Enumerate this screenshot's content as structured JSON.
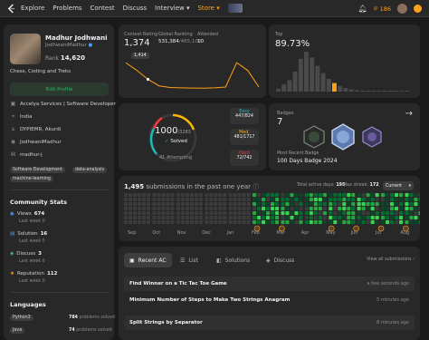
{
  "nav": {
    "items": [
      "Explore",
      "Problems",
      "Contest",
      "Discuss",
      "Interview",
      "Store"
    ],
    "streak": "186",
    "accent": "#ffa116"
  },
  "profile": {
    "name": "Madhur Jodhwani",
    "handle": "JodhwaniMadhur",
    "rank_label": "Rank",
    "rank_value": "14,620",
    "bio": "Chess, Coding and Treks",
    "edit_label": "Edit Profile",
    "work": "Accelya Services | Software Developer",
    "country": "India",
    "school": "DYPIEMR, Akurdi",
    "github": "JodhwaniMadhur",
    "website": "madhur-j",
    "tags": [
      "Software Development",
      "data-analysis",
      "machine-learning"
    ],
    "community_title": "Community Stats",
    "stats": [
      {
        "label": "Views",
        "value": "674",
        "sub": "Last week",
        "delta": "0",
        "icon": "eye-icon",
        "color": "#4a9ff5"
      },
      {
        "label": "Solution",
        "value": "16",
        "sub": "Last week",
        "delta": "0",
        "icon": "solution-icon",
        "color": "#4a9ff5"
      },
      {
        "label": "Discuss",
        "value": "3",
        "sub": "Last week",
        "delta": "0",
        "icon": "discuss-icon",
        "color": "#4ec9a4"
      },
      {
        "label": "Reputation",
        "value": "112",
        "sub": "Last week",
        "delta": "0",
        "icon": "reputation-icon",
        "color": "#ffa116"
      }
    ],
    "languages_title": "Languages",
    "languages": [
      {
        "name": "Python3",
        "count": "784",
        "suffix": "problems solved"
      },
      {
        "name": "Java",
        "count": "74",
        "suffix": "problems solved"
      }
    ]
  },
  "contest": {
    "rating_label": "Contest Rating",
    "rating": "1,374",
    "global_label": "Global Ranking",
    "global": "531,384",
    "global_total": "/465,100",
    "attended_label": "Attended",
    "attended": "10",
    "tooltip": "1,414",
    "rating_series": [
      1500,
      1460,
      1414,
      1380,
      1372,
      1370,
      1369,
      1368,
      1370,
      1374,
      1500,
      1460,
      1374
    ]
  },
  "top": {
    "label": "Top",
    "value": "89.73%",
    "bars": [
      4,
      10,
      16,
      28,
      46,
      56,
      48,
      36,
      26,
      18,
      12,
      8,
      5,
      3,
      2,
      1,
      1,
      1,
      1,
      1,
      1,
      1,
      1,
      1
    ],
    "highlight_index": 10
  },
  "solved": {
    "count": "1000",
    "total": "/3283",
    "label": "Solved",
    "attempting": "41 Attempting",
    "easy": {
      "label": "Easy",
      "value": "447/824",
      "color": "#1cbaba"
    },
    "medium": {
      "label": "Med.",
      "value": "481/1717",
      "color": "#ffb700"
    },
    "hard": {
      "label": "Hard",
      "value": "72/742",
      "color": "#f63737"
    }
  },
  "badges": {
    "label": "Badges",
    "count": "7",
    "recent_label": "Most Recent Badge",
    "recent": "100 Days Badge 2024"
  },
  "heatmap": {
    "title_count": "1,495",
    "title_rest": "submissions in the past one year",
    "active_label": "Total active days:",
    "active": "195",
    "streak_label": "Max streak:",
    "streak": "172",
    "select": "Current",
    "months": [
      "Sep",
      "Oct",
      "Nov",
      "Dec",
      "Jan",
      "Feb",
      "Mar",
      "Apr",
      "May",
      "Jun",
      "Jul",
      "Aug"
    ]
  },
  "submissions": {
    "tabs": [
      {
        "label": "Recent AC",
        "icon": "recent-icon"
      },
      {
        "label": "List",
        "icon": "list-icon"
      },
      {
        "label": "Solutions",
        "icon": "solutions-icon"
      },
      {
        "label": "Discuss",
        "icon": "discuss-icon"
      }
    ],
    "view_all": "View all submissions",
    "rows": [
      {
        "title": "Find Winner on a Tic Tac Toe Game",
        "when": "a few seconds ago"
      },
      {
        "title": "Minimum Number of Steps to Make Two Strings Anagram",
        "when": "5 minutes ago"
      },
      {
        "title": "Split Strings by Separator",
        "when": "8 minutes ago"
      }
    ]
  }
}
